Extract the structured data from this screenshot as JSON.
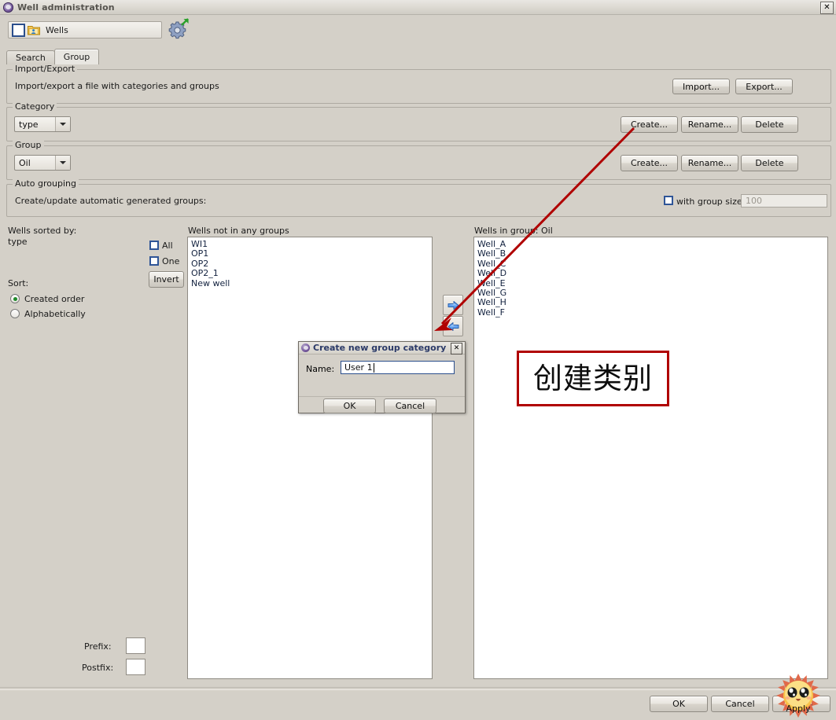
{
  "window": {
    "title": "Well administration",
    "icon": "app-purple-icon",
    "close_label": "✕"
  },
  "toolbar": {
    "wells_label": "Wells",
    "wells_checkbox_checked": false,
    "gear_icon": "gear-export-icon"
  },
  "tabs": [
    {
      "label": "Search",
      "active": false
    },
    {
      "label": "Group",
      "active": true
    }
  ],
  "import_export": {
    "legend": "Import/Export",
    "description": "Import/export a file with categories and groups",
    "import_label": "Import...",
    "export_label": "Export..."
  },
  "category": {
    "legend": "Category",
    "value": "type",
    "create_label": "Create...",
    "rename_label": "Rename...",
    "delete_label": "Delete"
  },
  "group": {
    "legend": "Group",
    "value": "Oil",
    "create_label": "Create...",
    "rename_label": "Rename...",
    "delete_label": "Delete"
  },
  "auto_grouping": {
    "legend": "Auto grouping",
    "description": "Create/update automatic generated groups:",
    "with_group_size_label": "with group size:",
    "with_group_size_checked": false,
    "group_size_value": "100"
  },
  "left_panel": {
    "sorted_by_label": "Wells sorted by:",
    "sorted_by_value": "type",
    "all_label": "All",
    "all_checked": false,
    "one_label": "One",
    "one_checked": false,
    "invert_label": "Invert",
    "sort_label": "Sort:",
    "sort_options": [
      {
        "label": "Created order",
        "selected": true
      },
      {
        "label": "Alphabetically",
        "selected": false
      }
    ],
    "prefix_label": "Prefix:",
    "prefix_value": "",
    "postfix_label": "Postfix:",
    "postfix_value": ""
  },
  "ungrouped_list": {
    "title": "Wells not in any groups",
    "items": [
      "WI1",
      "OP1",
      "OP2",
      "OP2_1",
      "New well"
    ]
  },
  "grouped_list": {
    "title": "Wells in group: Oil",
    "items": [
      "Well_A",
      "Well_B",
      "Well_C",
      "Well_D",
      "Well_E",
      "Well_G",
      "Well_H",
      "Well_F"
    ]
  },
  "transfer_buttons": {
    "add_icon": "arrow-right-icon",
    "remove_icon": "arrow-left-icon"
  },
  "dialog": {
    "title": "Create new group category",
    "icon": "app-purple-icon",
    "close_label": "✕",
    "name_label": "Name:",
    "name_value": "User 1",
    "ok_label": "OK",
    "cancel_label": "Cancel"
  },
  "footer": {
    "ok_label": "OK",
    "cancel_label": "Cancel",
    "apply_label": "Apply"
  },
  "annotation": {
    "text": "创建类别",
    "box_color": "#b00000",
    "arrow_color": "#b00000"
  },
  "colors": {
    "background": "#d4d0c8",
    "list_background": "#ffffff",
    "list_text": "#13223f",
    "accent_blue": "#2b4e8c",
    "radio_green": "#1f8a2a"
  }
}
